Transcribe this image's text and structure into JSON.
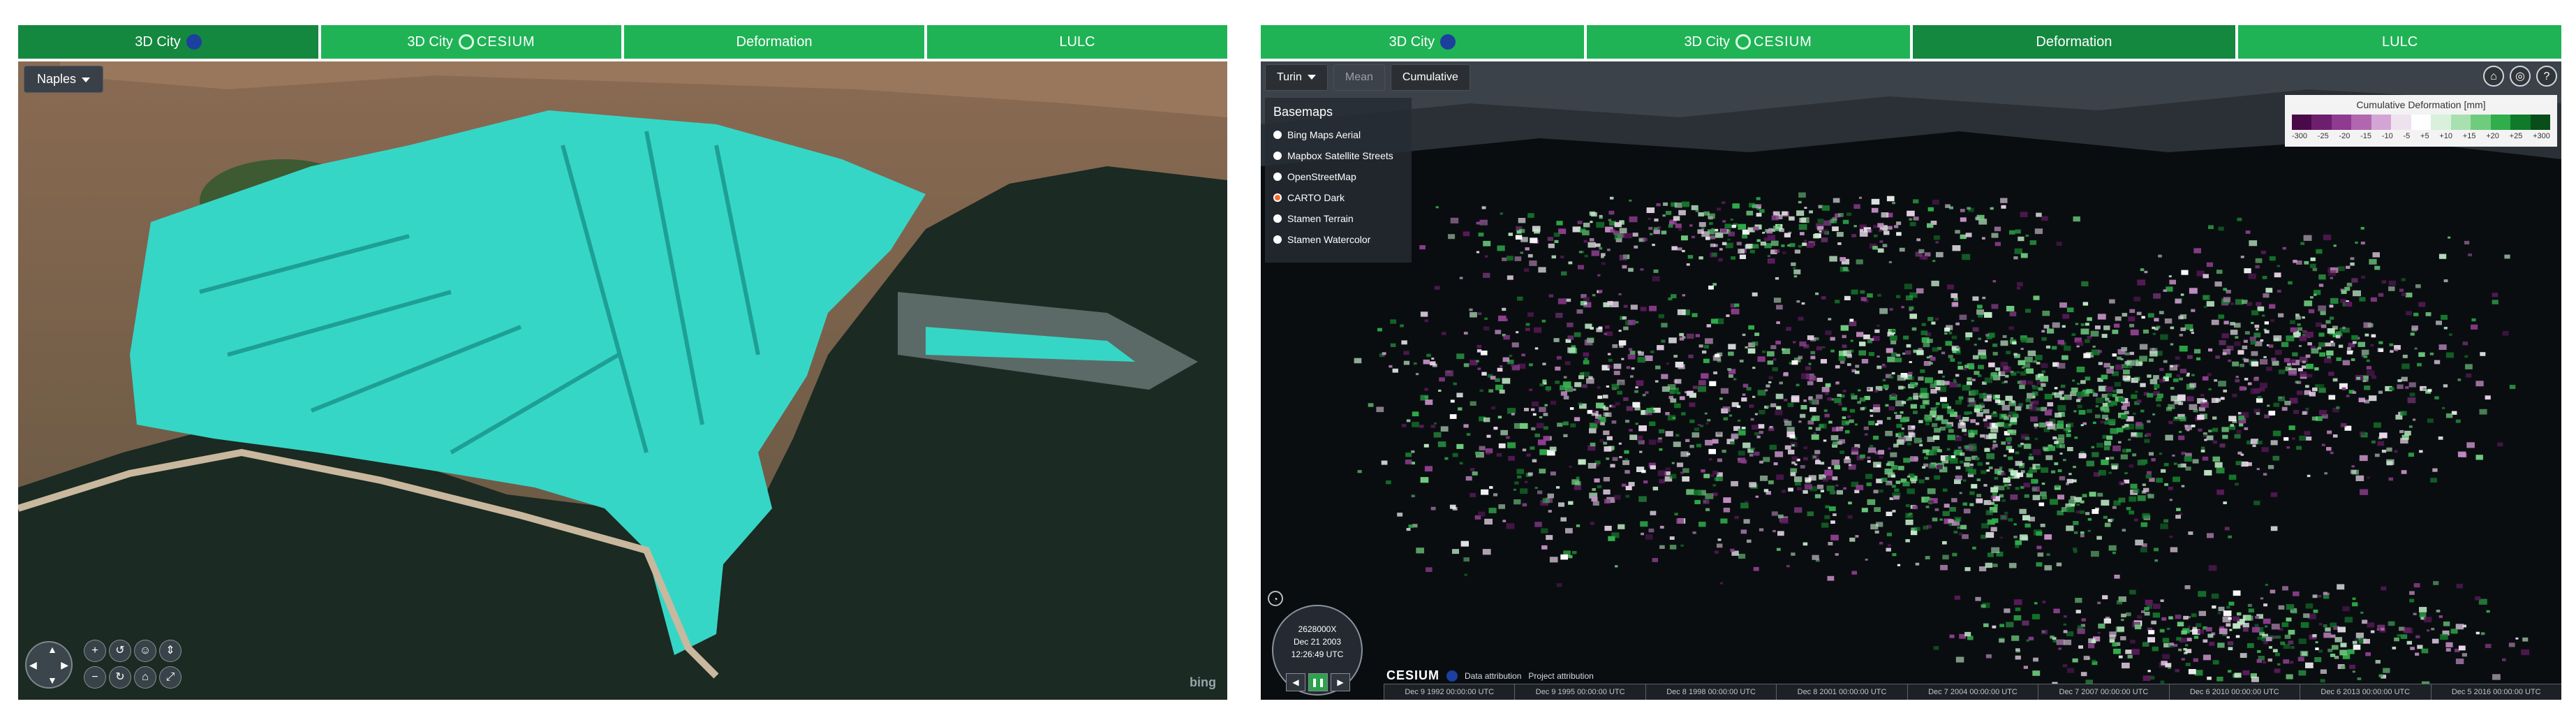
{
  "left": {
    "tabs": [
      {
        "label": "3D City",
        "icon": "nasa-logo-icon"
      },
      {
        "label": "3D City",
        "icon": "cesium-logo-icon",
        "brand": "CESIUM"
      },
      {
        "label": "Deformation"
      },
      {
        "label": "LULC"
      }
    ],
    "city_select": "Naples",
    "attribution": "bing",
    "colors": {
      "tab_green": "#1fb356",
      "building_cyan": "#36d6c6",
      "sea": "#1a2a24"
    }
  },
  "right": {
    "tabs": [
      {
        "label": "3D City",
        "icon": "nasa-logo-icon"
      },
      {
        "label": "3D City",
        "icon": "cesium-logo-icon",
        "brand": "CESIUM"
      },
      {
        "label": "Deformation",
        "active": true
      },
      {
        "label": "LULC"
      }
    ],
    "city_select": "Turin",
    "mode_buttons": {
      "mean": "Mean",
      "cumulative": "Cumulative"
    },
    "basemaps": {
      "title": "Basemaps",
      "options": [
        "Bing Maps Aerial",
        "Mapbox Satellite Streets",
        "OpenStreetMap",
        "CARTO Dark",
        "Stamen Terrain",
        "Stamen Watercolor"
      ],
      "selected": "CARTO Dark"
    },
    "legend": {
      "title": "Cumulative Deformation [mm]",
      "ticks": [
        "-300",
        "-25",
        "-20",
        "-15",
        "-10",
        "-5",
        "+5",
        "+10",
        "+15",
        "+20",
        "+25",
        "+300"
      ],
      "colors": [
        "#4a0a4a",
        "#6d1f6d",
        "#8f3b8f",
        "#b067b0",
        "#d4a5d4",
        "#efe2ef",
        "#ffffff",
        "#d9f0dc",
        "#a8e0b0",
        "#6fcc7f",
        "#2fae4b",
        "#0f7a2a",
        "#084d1a"
      ]
    },
    "clock": {
      "line1": "2628000X",
      "line2": "Dec 21 2003",
      "line3": "12:26:49 UTC"
    },
    "credits": {
      "brand": "CESIUM",
      "data_attribution": "Data attribution",
      "project_attribution": "Project attribution"
    },
    "timeline": [
      "Dec 9 1992 00:00:00 UTC",
      "Dec 9 1995 00:00:00 UTC",
      "Dec 8 1998 00:00:00 UTC",
      "Dec 8 2001 00:00:00 UTC",
      "Dec 7 2004 00:00:00 UTC",
      "Dec 7 2007 00:00:00 UTC",
      "Dec 6 2010 00:00:00 UTC",
      "Dec 6 2013 00:00:00 UTC",
      "Dec 5 2016 00:00:00 UTC"
    ]
  }
}
